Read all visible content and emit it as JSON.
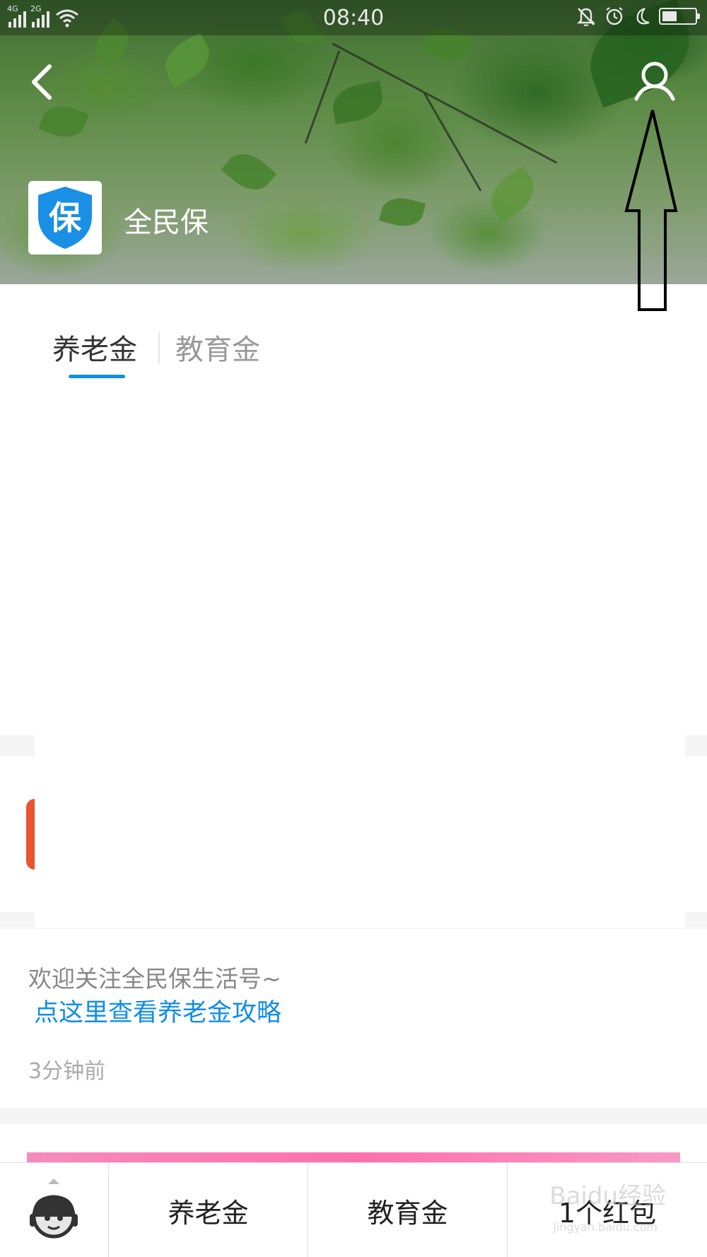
{
  "status_bar": {
    "network_1": "4G",
    "network_2": "2G",
    "time": "08:40",
    "battery_level": 0.4
  },
  "header": {
    "back_icon": "chevron-left-icon",
    "profile_icon": "user-icon",
    "brand_logo_char": "保",
    "brand_name": "全民保"
  },
  "tabs": {
    "items": [
      {
        "label": "养老金",
        "active": true
      },
      {
        "label": "教育金",
        "active": false
      }
    ]
  },
  "message": {
    "text": "欢迎关注全民保生活号~",
    "link": "点这里查看养老金攻略",
    "time": "3分钟前"
  },
  "bottom_bar": {
    "assistant_icon": "robot-assistant-icon",
    "items": [
      {
        "label": "养老金"
      },
      {
        "label": "教育金"
      },
      {
        "label": "1个红包"
      }
    ]
  },
  "watermark": {
    "text": "Baidu经验",
    "sub": "jingyan.baidu.com"
  },
  "colors": {
    "accent": "#108ee9",
    "brand_shield": "#1a8fe6",
    "banner_pink": "#ff6fae",
    "red_accent": "#e8552f"
  }
}
